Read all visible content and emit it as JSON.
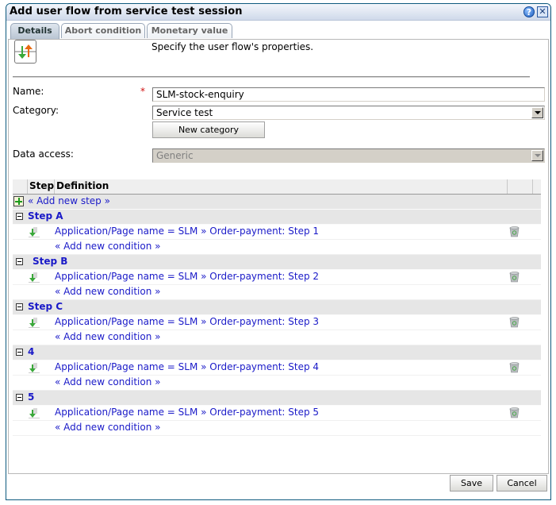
{
  "dialog": {
    "title": "Add user flow from service test session",
    "help_icon": "help-icon",
    "close_icon": "close-icon"
  },
  "tabs": [
    {
      "label": "Details",
      "active": true
    },
    {
      "label": "Abort condition",
      "active": false
    },
    {
      "label": "Monetary value",
      "active": false
    }
  ],
  "header": {
    "icon": "user-flow-icon",
    "description": "Specify the user flow's properties."
  },
  "form": {
    "name_label": "Name:",
    "required_mark": "*",
    "name_value": "SLM-stock-enquiry",
    "category_label": "Category:",
    "category_value": "Service test",
    "new_category_button": "New category",
    "data_access_label": "Data access:",
    "data_access_value": "Generic"
  },
  "grid": {
    "columns": [
      "Step",
      "Definition"
    ],
    "add_step_label": "« Add new step »",
    "add_condition_label": "« Add new condition »",
    "steps": [
      {
        "name": "Step A",
        "condition": "Application/Page name = SLM » Order-payment: Step 1"
      },
      {
        "name": "Step B",
        "condition": "Application/Page name = SLM » Order-payment: Step 2"
      },
      {
        "name": "Step C",
        "condition": "Application/Page name = SLM » Order-payment: Step 3"
      },
      {
        "name": "4",
        "condition": "Application/Page name = SLM » Order-payment: Step 4"
      },
      {
        "name": "5",
        "condition": "Application/Page name = SLM » Order-payment: Step 5"
      }
    ]
  },
  "footer": {
    "save_label": "Save",
    "cancel_label": "Cancel"
  }
}
